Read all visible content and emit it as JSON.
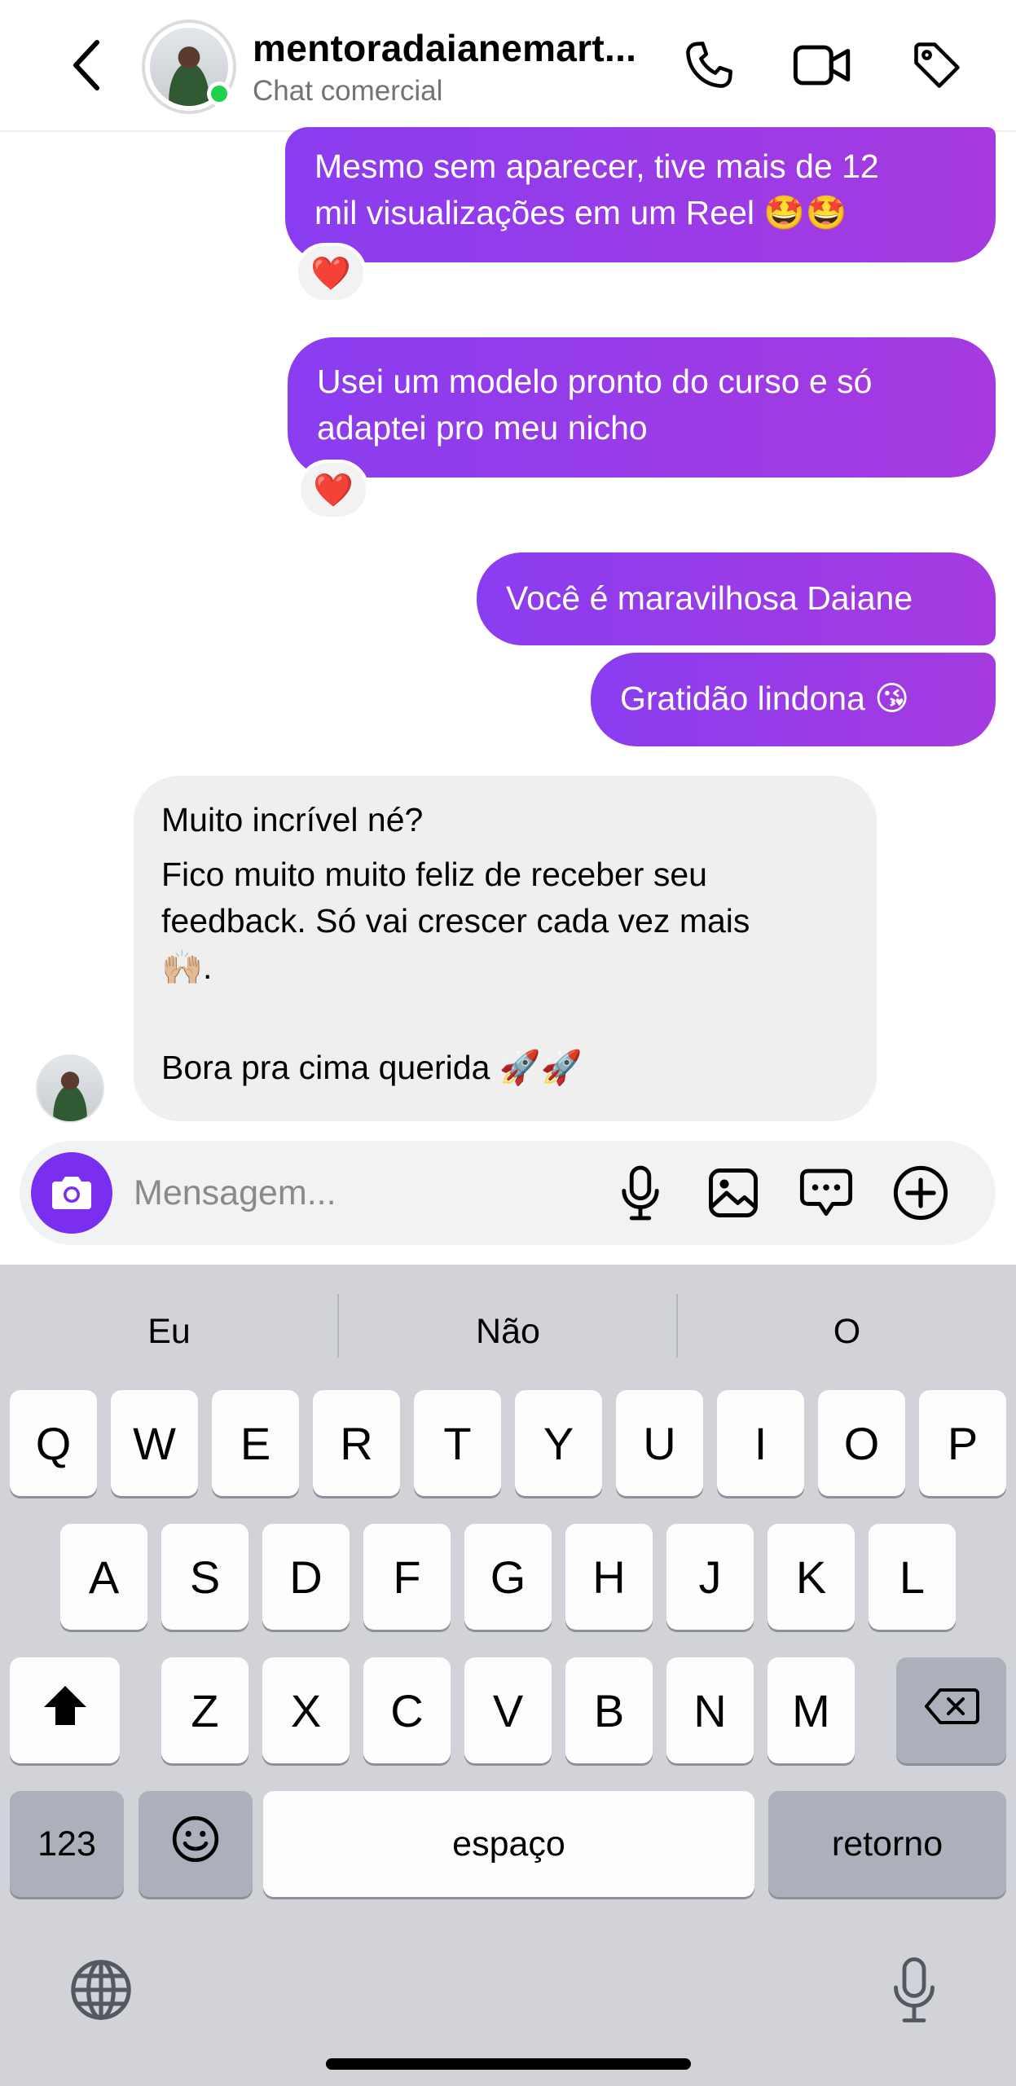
{
  "header": {
    "contact_name": "mentoradaianemart...",
    "subtitle": "Chat comercial",
    "icons": [
      "back-arrow-icon",
      "phone-icon",
      "video-camera-icon",
      "tag-icon"
    ]
  },
  "messages": [
    {
      "direction": "outgoing",
      "lines": [
        "Mesmo sem aparecer, tive mais de 12",
        "mil visualizações em um Reel 🤩🤩"
      ],
      "reaction": "❤️"
    },
    {
      "direction": "outgoing",
      "lines": [
        "Usei um modelo pronto do curso e só",
        "adaptei pro meu nicho"
      ],
      "reaction": "❤️"
    },
    {
      "direction": "outgoing",
      "lines": [
        "Você é maravilhosa Daiane"
      ]
    },
    {
      "direction": "outgoing",
      "lines": [
        "Gratidão lindona 😘"
      ]
    },
    {
      "direction": "incoming",
      "lines": [
        "Muito incrível né?",
        "Fico muito muito feliz de receber seu",
        "feedback. Só vai crescer cada vez mais",
        "🙌🏼.",
        "",
        "Bora pra cima querida 🚀🚀"
      ]
    }
  ],
  "composer": {
    "placeholder": "Mensagem...",
    "icons": [
      "camera-icon",
      "microphone-icon",
      "image-icon",
      "chat-bubble-icon",
      "plus-circle-icon"
    ]
  },
  "keyboard": {
    "suggestions": [
      "Eu",
      "Não",
      "O"
    ],
    "row1": [
      "Q",
      "W",
      "E",
      "R",
      "T",
      "Y",
      "U",
      "I",
      "O",
      "P"
    ],
    "row2": [
      "A",
      "S",
      "D",
      "F",
      "G",
      "H",
      "J",
      "K",
      "L"
    ],
    "row3": [
      "Z",
      "X",
      "C",
      "V",
      "B",
      "N",
      "M"
    ],
    "numbers_label": "123",
    "space_label": "espaço",
    "return_label": "retorno",
    "icons": [
      "shift-icon",
      "backspace-icon",
      "emoji-icon",
      "globe-icon",
      "dictation-microphone-icon"
    ]
  }
}
